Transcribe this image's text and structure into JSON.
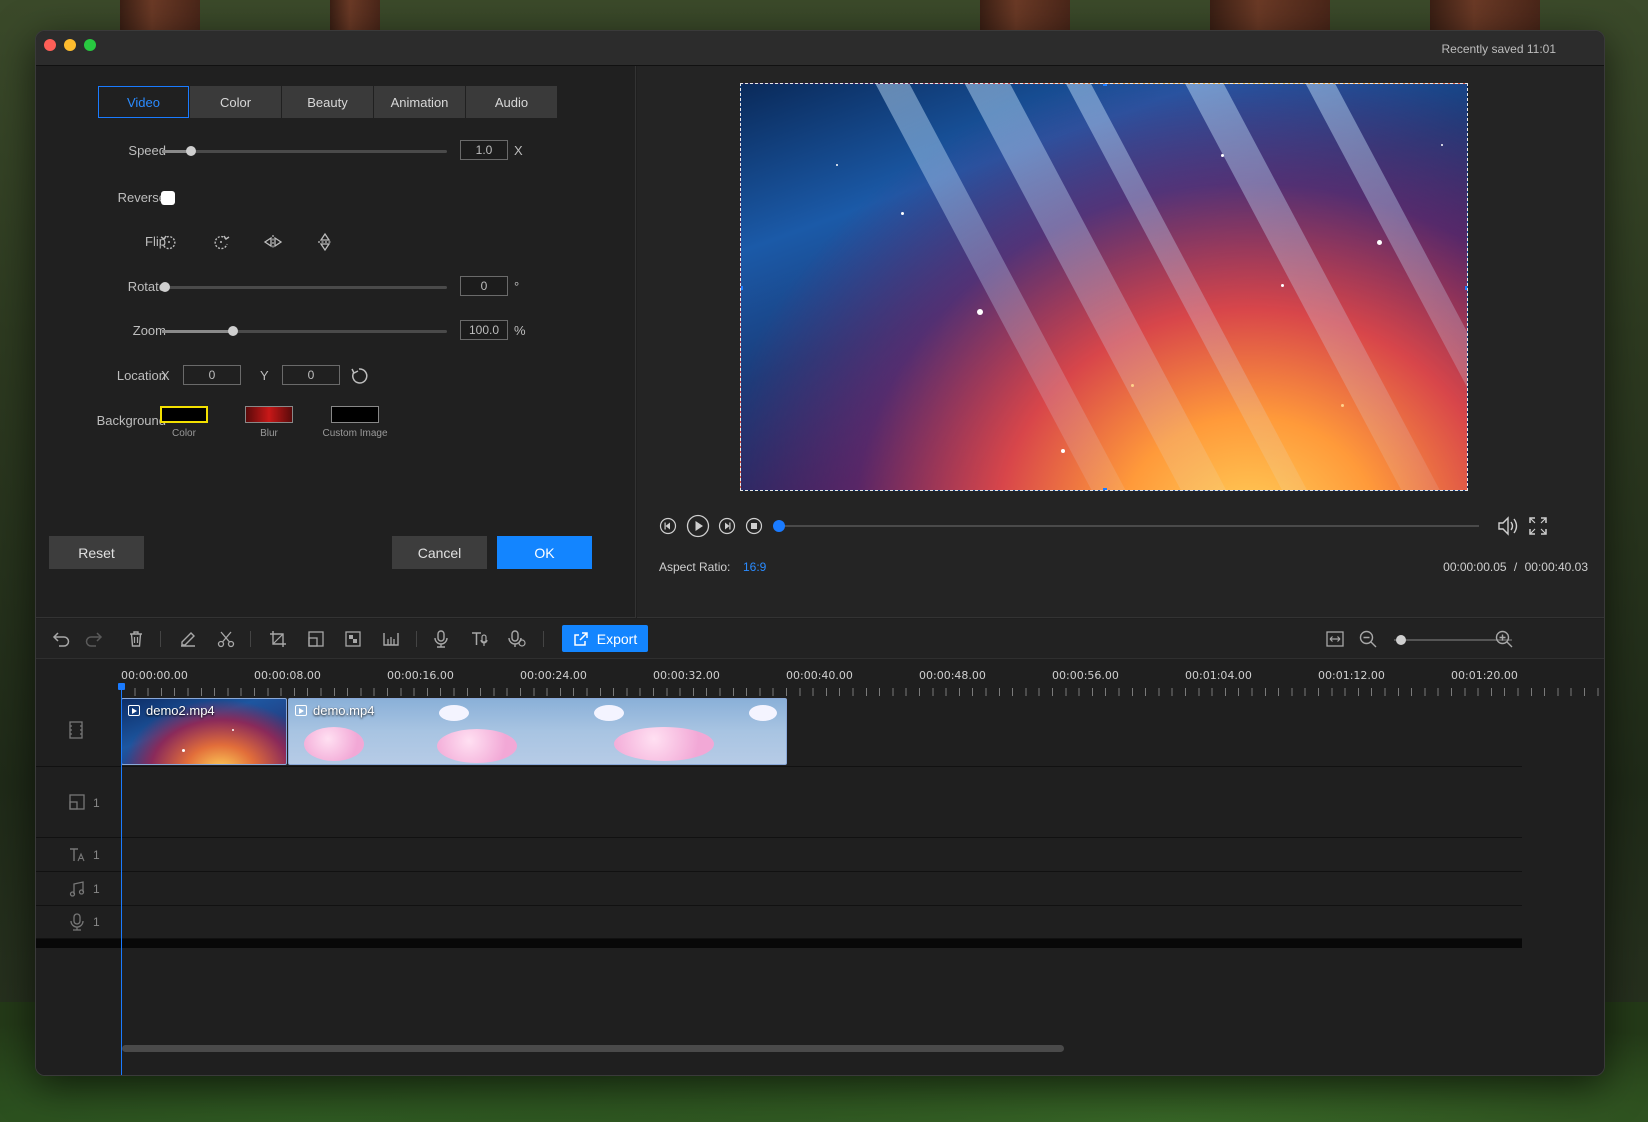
{
  "titlebar": {
    "saved_text": "Recently saved  11:01"
  },
  "props": {
    "tabs": [
      {
        "label": "Video",
        "active": true
      },
      {
        "label": "Color",
        "active": false
      },
      {
        "label": "Beauty",
        "active": false
      },
      {
        "label": "Animation",
        "active": false
      },
      {
        "label": "Audio",
        "active": false
      }
    ],
    "speed": {
      "label": "Speed",
      "value": "1.0",
      "unit": "X",
      "level": 0.1
    },
    "reverse": {
      "label": "Reverse",
      "checked": false
    },
    "flip": {
      "label": "Flip",
      "icons": [
        "rotate-left-icon",
        "rotate-right-icon",
        "flip-horizontal-icon",
        "flip-vertical-icon"
      ]
    },
    "rotate": {
      "label": "Rotate",
      "value": "0",
      "unit": "°",
      "level": 0.0
    },
    "zoom": {
      "label": "Zoom",
      "value": "100.0",
      "unit": "%",
      "level": 0.25
    },
    "location": {
      "label": "Location",
      "x_label": "X",
      "x_value": "0",
      "y_label": "Y",
      "y_value": "0"
    },
    "background": {
      "label": "Background",
      "options": [
        {
          "label": "Color",
          "swatch": "#f3e000"
        },
        {
          "label": "Blur",
          "swatch": "#c81818"
        },
        {
          "label": "Custom Image",
          "swatch": "#000000"
        }
      ]
    },
    "buttons": {
      "reset": "Reset",
      "cancel": "Cancel",
      "ok": "OK"
    }
  },
  "preview": {
    "aspect_label": "Aspect Ratio:",
    "aspect_value": "16:9",
    "current_time": "00:00:00.05",
    "separator": "/",
    "total_time": "00:00:40.03",
    "progress": 0.0
  },
  "toolbar": {
    "export_label": "Export",
    "accent": "#1385ff"
  },
  "timeline": {
    "ruler": [
      "00:00:00.00",
      "00:00:08.00",
      "00:00:16.00",
      "00:00:24.00",
      "00:00:32.00",
      "00:00:40.00",
      "00:00:48.00",
      "00:00:56.00",
      "00:01:04.00",
      "00:01:12.00",
      "00:01:20.00"
    ],
    "clips": [
      {
        "name": "demo2.mp4"
      },
      {
        "name": "demo.mp4"
      }
    ],
    "tracks": [
      {
        "icon": "pip-track-icon",
        "count": "1"
      },
      {
        "icon": "text-track-icon",
        "count": "1"
      },
      {
        "icon": "music-track-icon",
        "count": "1"
      },
      {
        "icon": "voice-track-icon",
        "count": "1"
      }
    ]
  }
}
